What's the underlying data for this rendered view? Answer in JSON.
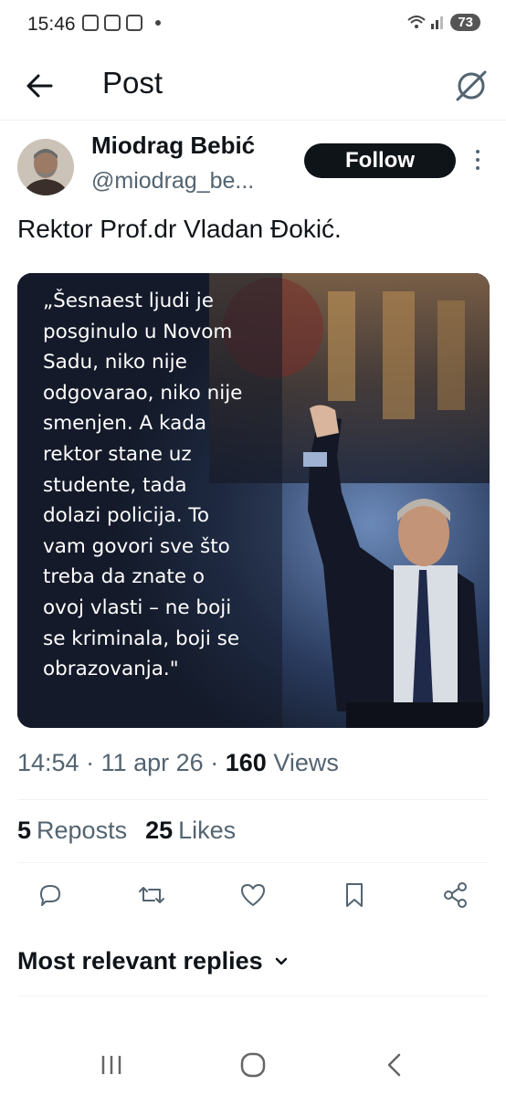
{
  "status_bar": {
    "time": "15:46",
    "battery": "73"
  },
  "header": {
    "title": "Post"
  },
  "author": {
    "name": "Miodrag Bebić",
    "handle": "@miodrag_be..."
  },
  "follow_label": "Follow",
  "tweet": {
    "text": "Rektor Prof.dr Vladan Đokić."
  },
  "media": {
    "quote": "„Šesnaest ljudi je\nposginulo u Novom\nSadu, niko nije\nodgovarao, niko nije\nsmenjen. A kada\nrektor stane uz\nstudente, tada\ndolazi policija. To\nvam govori sve što\ntreba da znate o\novoj vlasti – ne boji\nse kriminala, boji se\nobrazovanja.\""
  },
  "meta": {
    "time": "14:54",
    "date": "11 apr 26",
    "views_count": "160",
    "views_label": "Views",
    "sep": "·"
  },
  "stats": {
    "reposts_count": "5",
    "reposts_label": "Reposts",
    "likes_count": "25",
    "likes_label": "Likes"
  },
  "actions": [
    "reply-icon",
    "repost-icon",
    "like-icon",
    "bookmark-icon",
    "share-icon"
  ],
  "replies": {
    "heading": "Most relevant replies"
  },
  "colors": {
    "primary_text": "#0f1419",
    "secondary_text": "#536471",
    "divider": "#eff3f4",
    "follow_bg": "#0f1419"
  }
}
